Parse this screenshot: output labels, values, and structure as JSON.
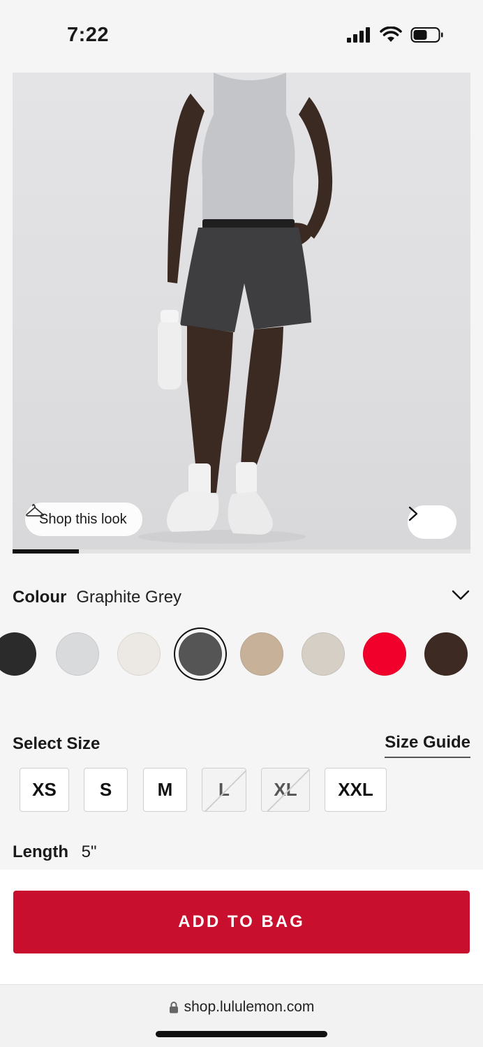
{
  "status_bar": {
    "time": "7:22",
    "icons": [
      "cellular-signal-icon",
      "wifi-icon",
      "battery-icon"
    ]
  },
  "hero": {
    "shop_look_label": "Shop this look",
    "image_progress": 0.145
  },
  "colour": {
    "label": "Colour",
    "selected": "Graphite Grey",
    "swatches": [
      {
        "color": "#2b2b2b",
        "selected": false
      },
      {
        "color": "#d9dadc",
        "selected": false
      },
      {
        "color": "#ece9e4",
        "selected": false
      },
      {
        "color": "#555555",
        "selected": true
      },
      {
        "color": "#c7b299",
        "selected": false
      },
      {
        "color": "#d6cfc6",
        "selected": false
      },
      {
        "color": "#f0002b",
        "selected": false
      },
      {
        "color": "#3d2a22",
        "selected": false
      }
    ]
  },
  "size": {
    "label": "Select Size",
    "guide_label": "Size Guide",
    "options": [
      {
        "label": "XS",
        "available": true
      },
      {
        "label": "S",
        "available": true
      },
      {
        "label": "M",
        "available": true
      },
      {
        "label": "L",
        "available": false
      },
      {
        "label": "XL",
        "available": false
      },
      {
        "label": "XXL",
        "available": true
      }
    ]
  },
  "length": {
    "label": "Length",
    "value": "5\""
  },
  "add_to_bag_label": "ADD TO BAG",
  "browser": {
    "url": "shop.lululemon.com"
  },
  "colors": {
    "accent": "#c8102e"
  }
}
